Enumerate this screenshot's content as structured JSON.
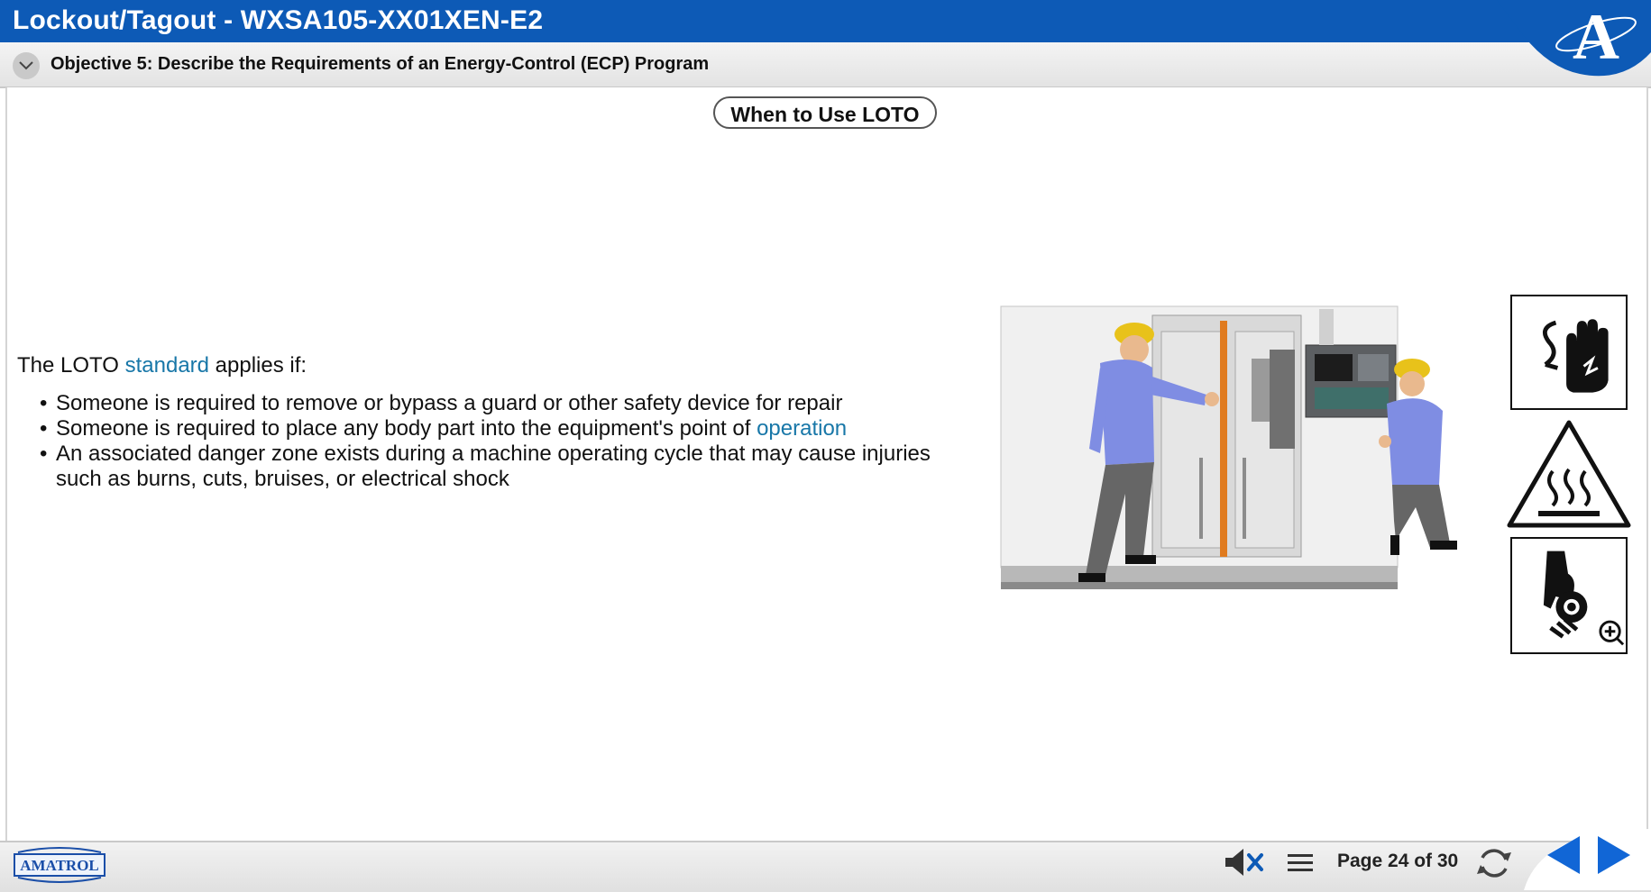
{
  "window": {
    "title": "Lockout/Tagout - WXSA105-XX01XEN-E2",
    "objective": "Objective 5: Describe the Requirements of an Energy-Control (ECP) Program",
    "logo_letter": "A"
  },
  "content": {
    "section_title": "When to Use LOTO",
    "intro_prefix": "The LOTO ",
    "intro_link": "standard",
    "intro_suffix": " applies if:",
    "bullets": [
      {
        "text": "Someone is required to remove or bypass a guard or other safety device for repair",
        "link": ""
      },
      {
        "text": "Someone is required to place any body part into the equipment's point of ",
        "link": "operation"
      },
      {
        "text": "An associated danger zone exists during a machine operating cycle that may cause injuries such as burns, cuts, bruises, or electrical shock",
        "link": ""
      }
    ],
    "bullet_glyph": "•",
    "signs": [
      "electric-shock-hand-icon",
      "hot-surface-warning-icon",
      "entanglement-hand-roller-icon"
    ]
  },
  "footer": {
    "brand": "AMATROL",
    "page_label": "Page 24 of 30",
    "icons": [
      "mute-icon",
      "menu-icon",
      "refresh-icon",
      "prev-arrow-icon",
      "next-arrow-icon"
    ]
  },
  "colors": {
    "header_blue": "#0d5ab6",
    "link_blue": "#1877a8",
    "nav_blue": "#1166d6"
  }
}
